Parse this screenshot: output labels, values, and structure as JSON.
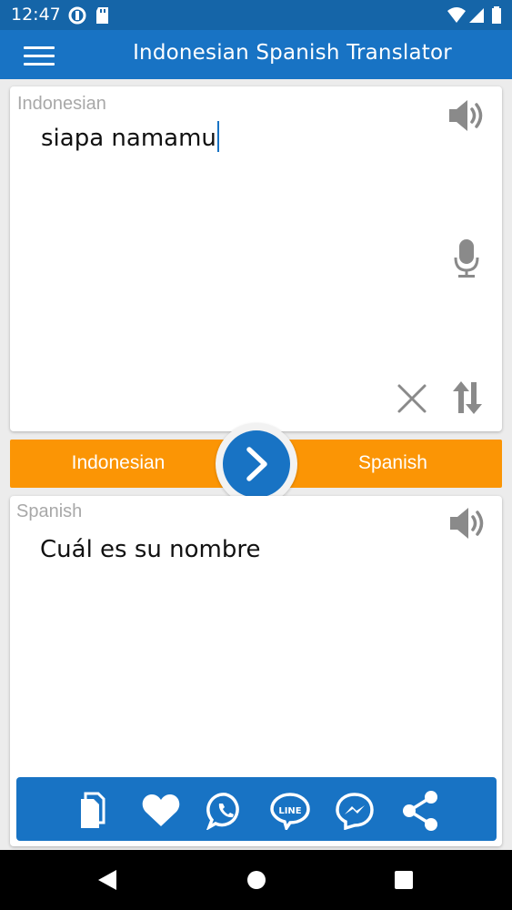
{
  "status_bar": {
    "time": "12:47"
  },
  "app_bar": {
    "title": "Indonesian Spanish Translator"
  },
  "source": {
    "language_label": "Indonesian",
    "text": "siapa namamu"
  },
  "language_bar": {
    "source_language": "Indonesian",
    "target_language": "Spanish"
  },
  "target": {
    "language_label": "Spanish",
    "text": "Cuál es su nombre"
  },
  "share_bar": {
    "line_label": "LINE",
    "icons": [
      "copy-icon",
      "heart-icon",
      "whatsapp-icon",
      "line-icon",
      "messenger-icon",
      "share-icon"
    ]
  },
  "colors": {
    "status_bar": "#1565a8",
    "app_bar": "#1873c4",
    "accent_orange": "#fb9505",
    "icon_gray": "#8a8a8a"
  }
}
